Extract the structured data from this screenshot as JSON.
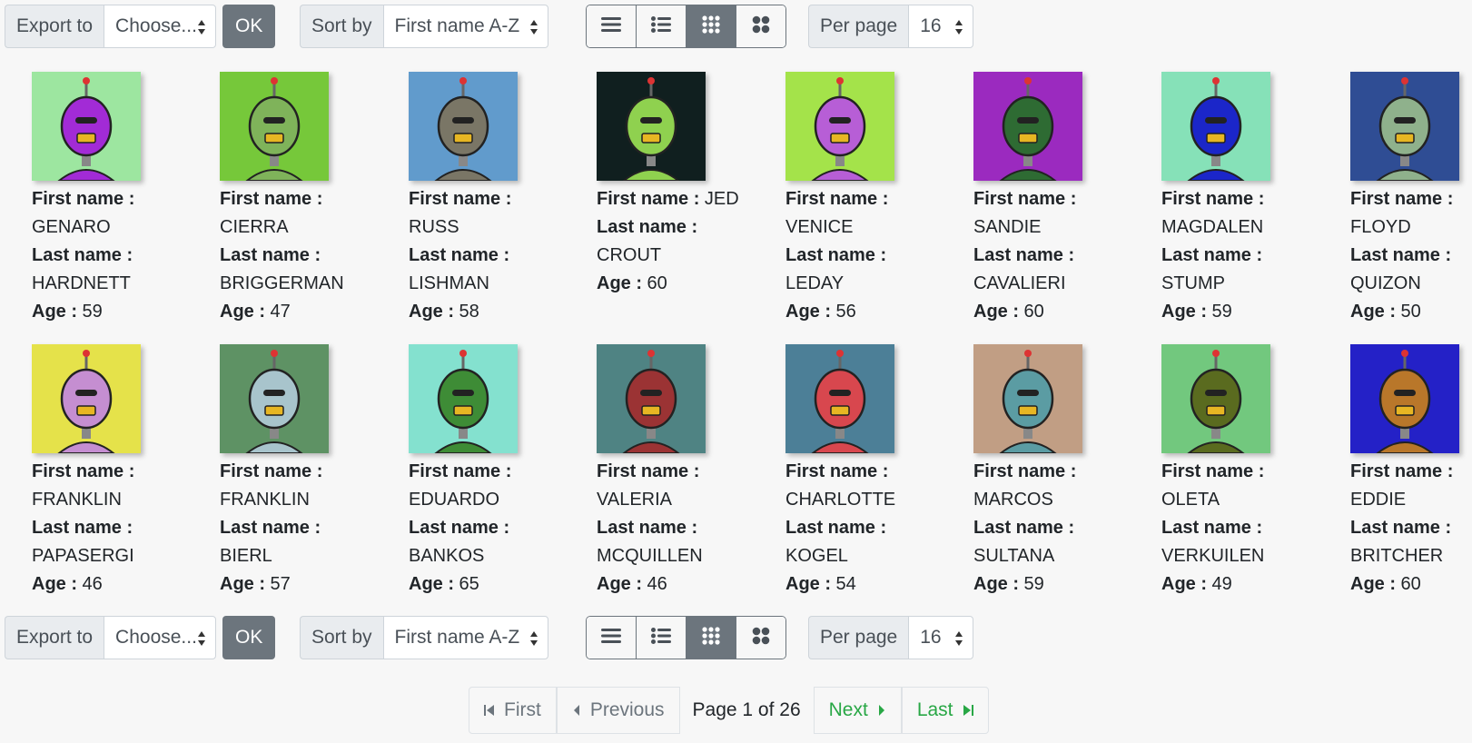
{
  "toolbar": {
    "export_label": "Export to",
    "export_value": "Choose...",
    "ok_label": "OK",
    "sort_label": "Sort by",
    "sort_value": "First name A-Z",
    "per_page_label": "Per page",
    "per_page_value": "16",
    "views": [
      "list-view-icon",
      "detail-list-view-icon",
      "small-grid-view-icon",
      "large-grid-view-icon"
    ],
    "active_view": 2
  },
  "labels": {
    "first": "First name :",
    "last": "Last name :",
    "age": "Age :"
  },
  "people": [
    {
      "first": "GENARO",
      "last": "HARDNETT",
      "age": "59",
      "bg": "#9de6a0",
      "head": "#a22bd6"
    },
    {
      "first": "CIERRA",
      "last": "BRIGGERMAN",
      "age": "47",
      "bg": "#76c83a",
      "head": "#7fb35a"
    },
    {
      "first": "RUSS",
      "last": "LISHMAN",
      "age": "58",
      "bg": "#619bcc",
      "head": "#7a7666"
    },
    {
      "first": "JED",
      "last": "CROUT",
      "age": "60",
      "bg": "#101f1f",
      "head": "#8fd14f"
    },
    {
      "first": "VENICE",
      "last": "LEDAY",
      "age": "56",
      "bg": "#a4e34a",
      "head": "#b75ed6"
    },
    {
      "first": "SANDIE",
      "last": "CAVALIERI",
      "age": "60",
      "bg": "#9b2abf",
      "head": "#2e6b33"
    },
    {
      "first": "MAGDALEN",
      "last": "STUMP",
      "age": "59",
      "bg": "#86e1b8",
      "head": "#1b26c9"
    },
    {
      "first": "FLOYD",
      "last": "QUIZON",
      "age": "50",
      "bg": "#2f4d94",
      "head": "#8fb18c"
    },
    {
      "first": "FRANKLIN",
      "last": "PAPASERGI",
      "age": "46",
      "bg": "#e5e24a",
      "head": "#c58ed1"
    },
    {
      "first": "FRANKLIN",
      "last": "BIERL",
      "age": "57",
      "bg": "#5e9264",
      "head": "#a8c4cc"
    },
    {
      "first": "EDUARDO",
      "last": "BANKOS",
      "age": "65",
      "bg": "#84e1cf",
      "head": "#3e8c36"
    },
    {
      "first": "VALERIA",
      "last": "MCQUILLEN",
      "age": "46",
      "bg": "#4f8383",
      "head": "#9b3334"
    },
    {
      "first": "CHARLOTTE",
      "last": "KOGEL",
      "age": "54",
      "bg": "#4c7f97",
      "head": "#d8474e"
    },
    {
      "first": "MARCOS",
      "last": "SULTANA",
      "age": "59",
      "bg": "#c19e84",
      "head": "#5b9ca3"
    },
    {
      "first": "OLETA",
      "last": "VERKUILEN",
      "age": "49",
      "bg": "#72c87e",
      "head": "#5a6b1f"
    },
    {
      "first": "EDDIE",
      "last": "BRITCHER",
      "age": "60",
      "bg": "#2421c7",
      "head": "#b9772a"
    }
  ],
  "pagination": {
    "first": "First",
    "previous": "Previous",
    "page_label": "Page 1 of 26",
    "next": "Next",
    "last": "Last"
  }
}
